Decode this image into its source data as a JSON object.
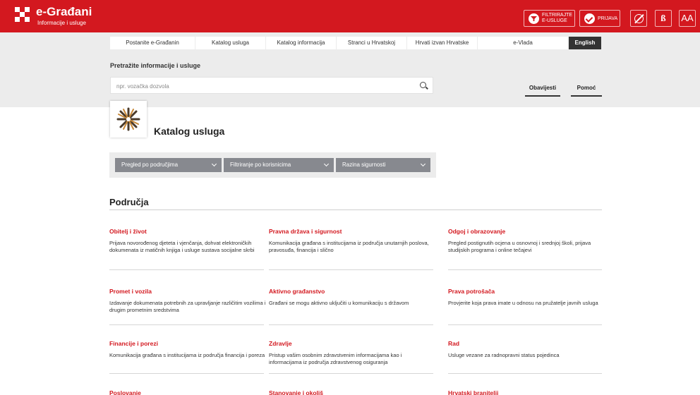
{
  "header": {
    "brand_title": "e-Građani",
    "brand_subtitle": "Informacije i usluge",
    "filter_button_label": "FILTRIRAJTE E-USLUGE",
    "login_label": "PRIJAVA",
    "font_icon_label": "ß",
    "text_size_label": "AA"
  },
  "nav": {
    "items": [
      "Postanite e-Građanin",
      "Katalog usluga",
      "Katalog informacija",
      "Stranci u Hrvatskoj",
      "Hrvati izvan Hrvatske",
      "e-Vlada",
      "English"
    ]
  },
  "search": {
    "label": "Pretražite informacije i usluge",
    "placeholder": "npr. vozačka dozvola",
    "value": ""
  },
  "side_links": {
    "obavijesti": "Obavijesti",
    "pomoc": "Pomoć"
  },
  "catalog": {
    "title": "Katalog usluga"
  },
  "filters": {
    "by_area": "Pregled po područjima",
    "by_user": "Filtriranje po korisnicima",
    "security": "Razina sigurnosti"
  },
  "areas": {
    "heading": "Područja",
    "items": [
      {
        "title": "Obitelj i život",
        "desc": "Prijava novorođenog djeteta i vjenčanja, dohvat elektroničkih dokumenata iz matičnih knjiga i usluge sustava socijalne skrbi"
      },
      {
        "title": "Pravna država i sigurnost",
        "desc": "Komunikacija građana s institucijama iz područja unutarnjih poslova, pravosuđa, financija i slično"
      },
      {
        "title": "Odgoj i obrazovanje",
        "desc": "Pregled postignutih ocjena u osnovnoj i srednjoj školi, prijava studijskih programa i online tečajevi"
      },
      {
        "title": "Promet i vozila",
        "desc": "Izdavanje dokumenata potrebnih za upravljanje različitim vozilima i drugim prometnim sredstvima"
      },
      {
        "title": "Aktivno građanstvo",
        "desc": "Građani se mogu aktivno uključiti u komunikaciju s državom"
      },
      {
        "title": "Prava potrošača",
        "desc": "Provjerite koja prava imate u odnosu na pružatelje javnih usluga"
      },
      {
        "title": "Financije i porezi",
        "desc": "Komunikacija građana s institucijama iz područja financija i poreza"
      },
      {
        "title": "Zdravlje",
        "desc": "Pristup vašim osobnim zdravstvenim informacijama kao i informacijama iz područja zdravstvenog osiguranja"
      },
      {
        "title": "Rad",
        "desc": "Usluge vezane za radnopravni status pojedinca"
      },
      {
        "title": "Poslovanje",
        "desc": ""
      },
      {
        "title": "Stanovanje i okoliš",
        "desc": ""
      },
      {
        "title": "Hrvatski branitelji",
        "desc": ""
      }
    ]
  },
  "colors": {
    "brand_red": "#d3181f",
    "band_grey": "#ececec",
    "filter_grey": "#87898f",
    "nav_dark": "#333333"
  }
}
